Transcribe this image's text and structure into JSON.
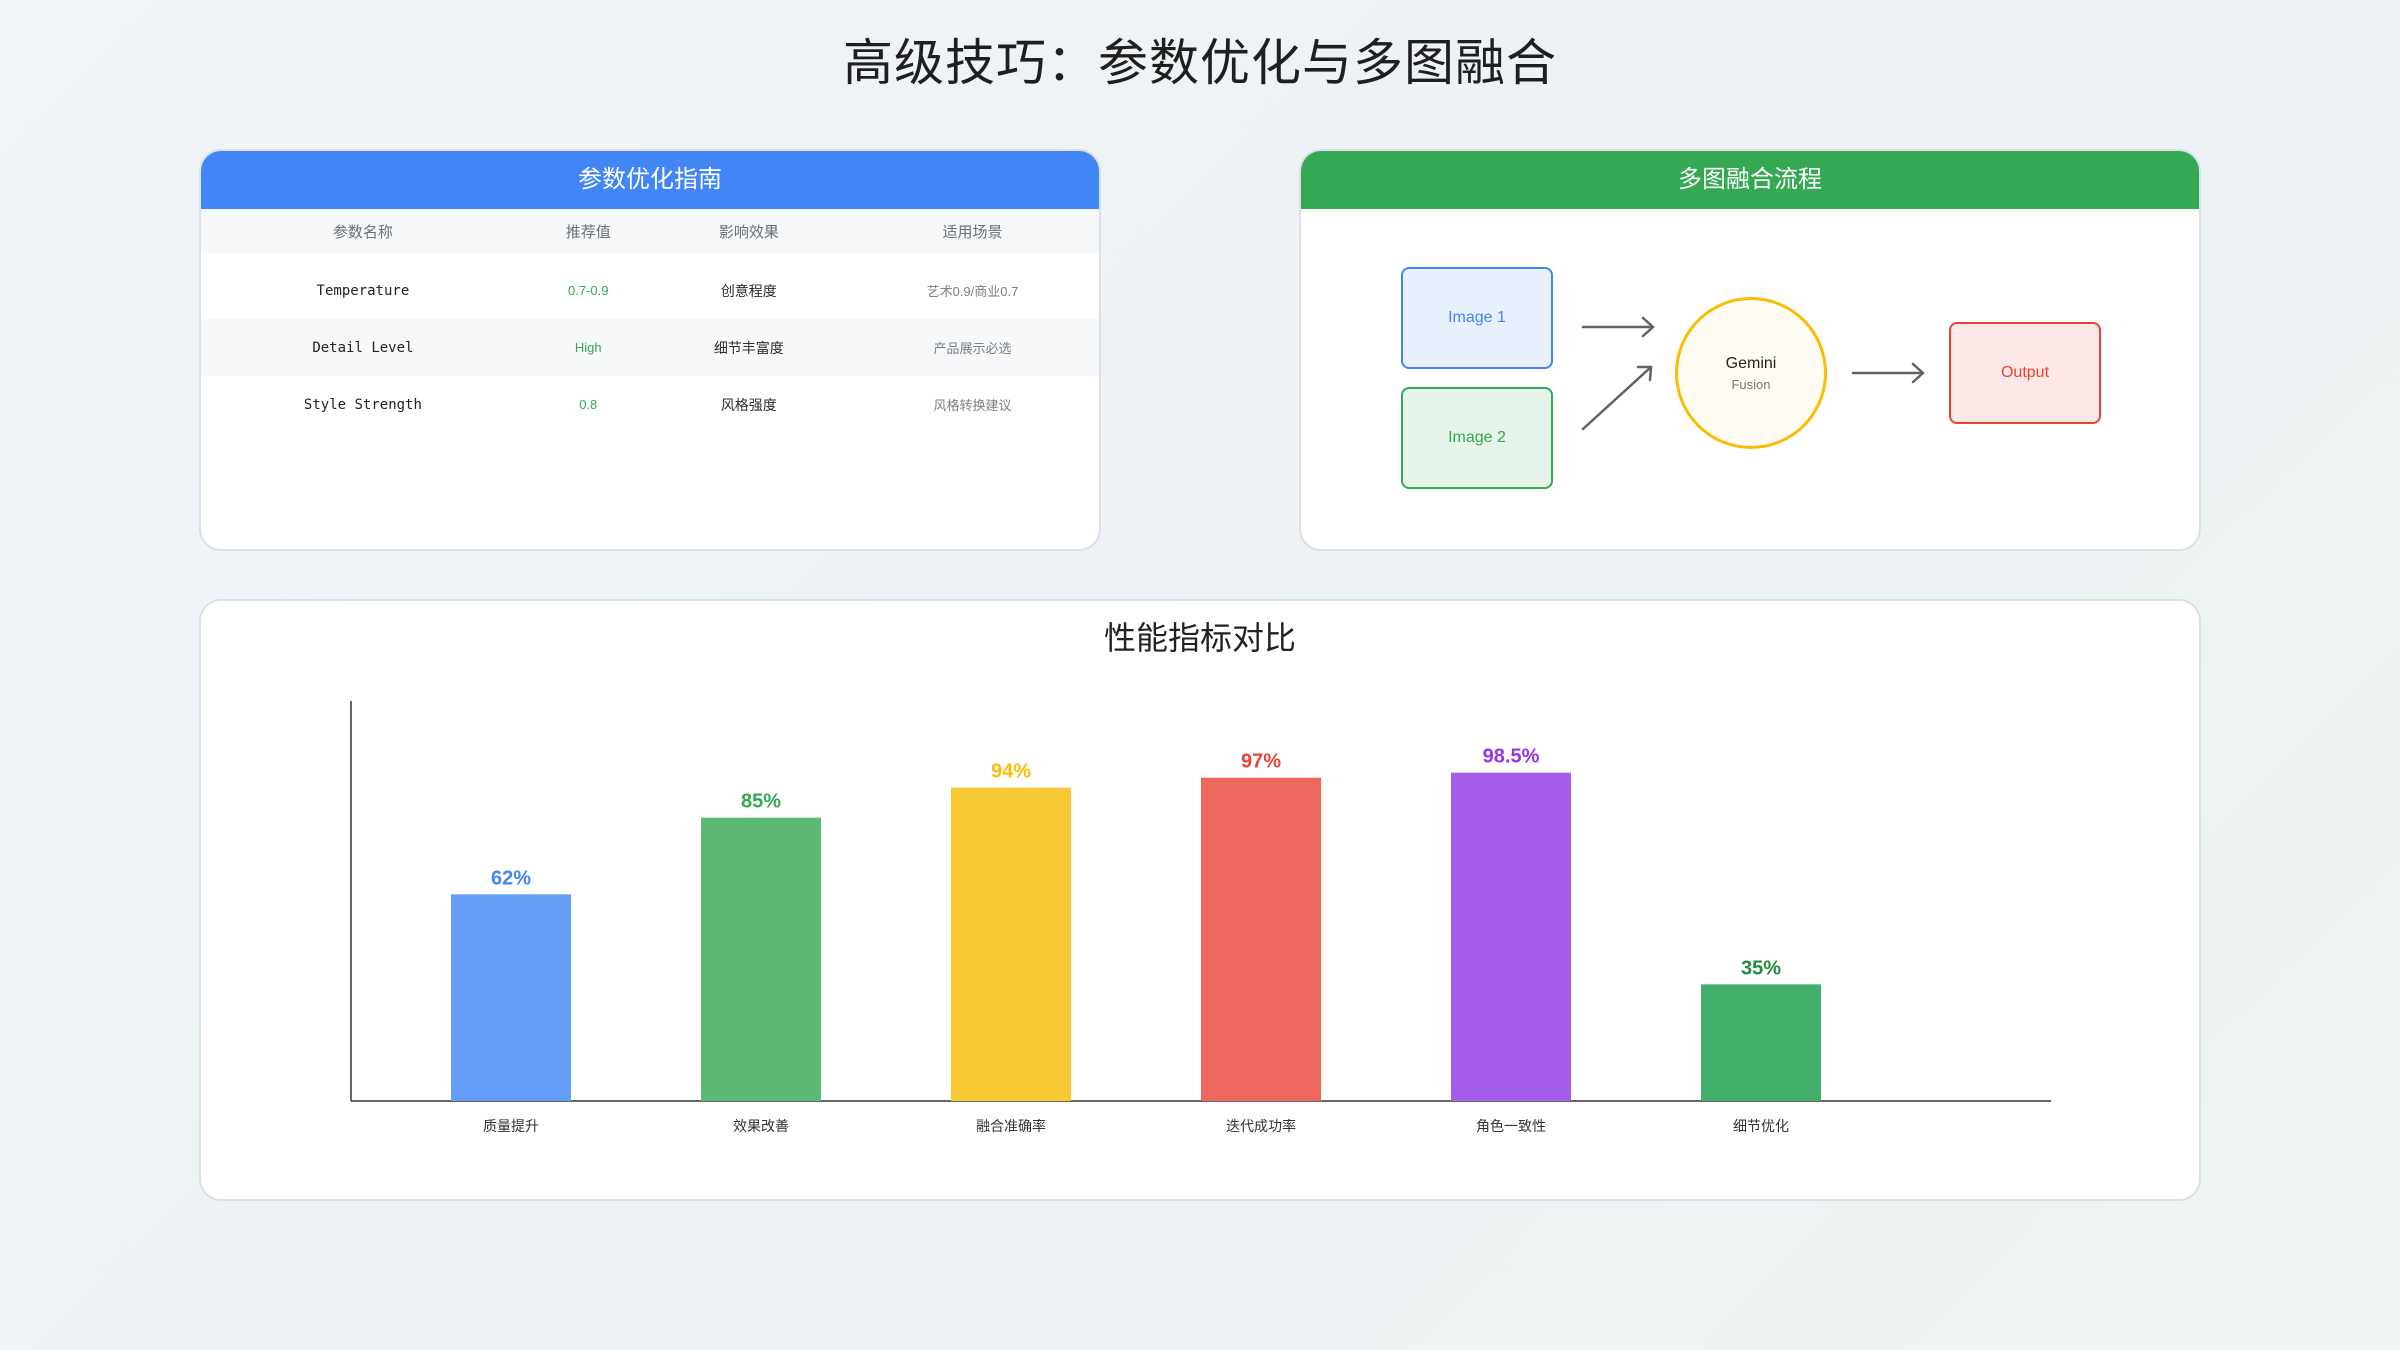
{
  "title": "高级技巧：参数优化与多图融合",
  "param_card": {
    "title": "参数优化指南",
    "headers": [
      "参数名称",
      "推荐值",
      "影响效果",
      "适用场景"
    ],
    "rows": [
      {
        "name": "Temperature",
        "value": "0.7-0.9",
        "effect": "创意程度",
        "scene": "艺术0.9/商业0.7"
      },
      {
        "name": "Detail Level",
        "value": "High",
        "effect": "细节丰富度",
        "scene": "产品展示必选"
      },
      {
        "name": "Style Strength",
        "value": "0.8",
        "effect": "风格强度",
        "scene": "风格转换建议"
      }
    ]
  },
  "fusion_card": {
    "title": "多图融合流程",
    "image1": "Image 1",
    "image2": "Image 2",
    "gemini_title": "Gemini",
    "gemini_sub": "Fusion",
    "output": "Output",
    "colors": {
      "image1": "#4285f4",
      "image2": "#34a853",
      "gemini": "#fbbc04",
      "output": "#ea4335"
    }
  },
  "chart_data": {
    "type": "bar",
    "title": "性能指标对比",
    "categories": [
      "质量提升",
      "效果改善",
      "融合准确率",
      "迭代成功率",
      "角色一致性",
      "细节优化"
    ],
    "values": [
      62,
      85,
      94,
      97,
      98.5,
      35
    ],
    "data_labels": [
      "62%",
      "85%",
      "94%",
      "97%",
      "98.5%",
      "35%"
    ],
    "bar_colors": [
      "#669df6",
      "#5bb974",
      "#f9c935",
      "#ee675c",
      "#a55eea",
      "#41af6a"
    ],
    "label_colors": [
      "#4285f4",
      "#34a853",
      "#fbbc04",
      "#ea4335",
      "#9334e6",
      "#1e8e3e"
    ],
    "ylim": [
      0,
      120
    ],
    "xlabel": "",
    "ylabel": "",
    "grid": false,
    "legend": false
  }
}
